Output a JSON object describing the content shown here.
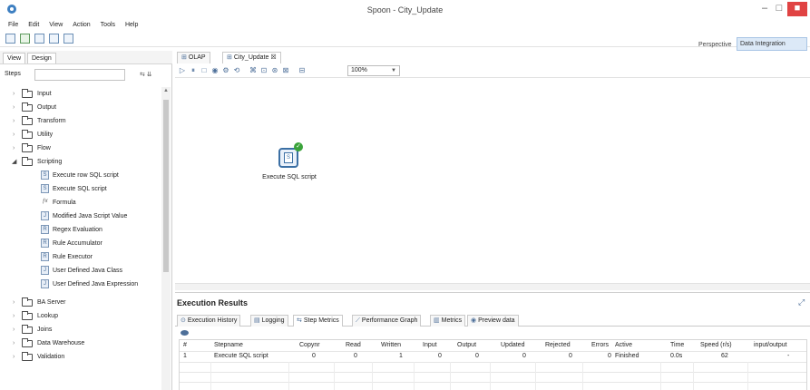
{
  "window": {
    "title": "Spoon - City_Update",
    "minimize": "–",
    "maximize": "□",
    "close": "■"
  },
  "menu": [
    "File",
    "Edit",
    "View",
    "Action",
    "Tools",
    "Help"
  ],
  "perspective": {
    "label": "Perspective",
    "button": "Data Integration"
  },
  "left_panel": {
    "tabs": [
      "View",
      "Design"
    ],
    "steps_label": "Steps",
    "search_value": "",
    "search_placeholder": "",
    "tree_icons": "⇆ ⇊"
  },
  "tree": {
    "before": [
      "Input",
      "Output",
      "Transform",
      "Utility",
      "Flow"
    ],
    "open_folder": "Scripting",
    "children": [
      "Execute row SQL script",
      "Execute SQL script",
      "Formula",
      "Modified Java Script Value",
      "Regex Evaluation",
      "Rule Accumulator",
      "Rule Executor",
      "User Defined Java Class",
      "User Defined Java Expression"
    ],
    "after": [
      "BA Server",
      "Lookup",
      "Joins",
      "Data Warehouse",
      "Validation"
    ]
  },
  "editor": {
    "tabs": [
      "OLAP",
      "City_Update"
    ],
    "tab_close": "☒",
    "zoom": "100%"
  },
  "canvas": {
    "step_label": "Execute SQL script"
  },
  "results": {
    "title": "Execution Results",
    "tabs": [
      "Execution History",
      "Logging",
      "Step Metrics",
      "Performance Graph",
      "Metrics",
      "Preview data"
    ],
    "columns": [
      "#",
      "Stepname",
      "Copynr",
      "Read",
      "Written",
      "Input",
      "Output",
      "Updated",
      "Rejected",
      "Errors",
      "Active",
      "Time",
      "Speed (r/s)",
      "input/output"
    ],
    "rows": [
      [
        "1",
        "Execute SQL script",
        "0",
        "0",
        "1",
        "0",
        "0",
        "0",
        "0",
        "0",
        "Finished",
        "0.0s",
        "62",
        "-"
      ]
    ]
  },
  "colors": {
    "accent": "#3b6fa4",
    "close_button": "#e04343",
    "success": "#3aa33a",
    "perspective_bg": "#dce9f7"
  }
}
